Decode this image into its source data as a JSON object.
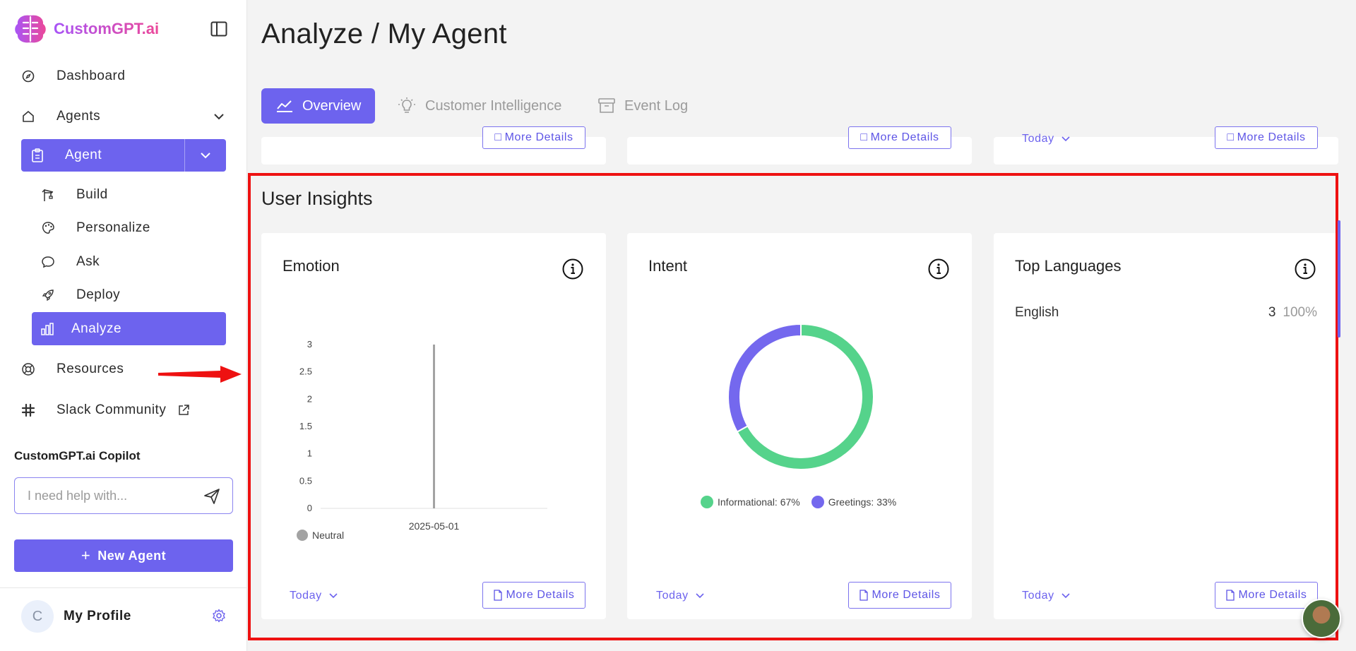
{
  "app": {
    "logo_text": "CustomGPT.ai"
  },
  "sidebar": {
    "items": [
      {
        "label": "Dashboard",
        "icon": "compass-icon"
      },
      {
        "label": "Agents",
        "icon": "home-icon"
      },
      {
        "label": "Agent",
        "icon": "clipboard-icon"
      },
      {
        "label": "Build",
        "icon": "crane-icon"
      },
      {
        "label": "Personalize",
        "icon": "palette-icon"
      },
      {
        "label": "Ask",
        "icon": "chat-bubble-icon"
      },
      {
        "label": "Deploy",
        "icon": "rocket-icon"
      },
      {
        "label": "Analyze",
        "icon": "bar-chart-icon"
      },
      {
        "label": "Resources",
        "icon": "lifebuoy-icon"
      },
      {
        "label": "Slack Community",
        "icon": "slack-icon"
      }
    ],
    "copilot_title": "CustomGPT.ai Copilot",
    "copilot_placeholder": "I need help with...",
    "new_agent_label": "New Agent",
    "profile_initial": "C",
    "profile_name": "My Profile"
  },
  "main": {
    "title": "Analyze / My Agent",
    "tabs": [
      {
        "label": "Overview",
        "active": true
      },
      {
        "label": "Customer Intelligence",
        "active": false
      },
      {
        "label": "Event Log",
        "active": false
      }
    ],
    "top_row": {
      "more_details_label": "More Details",
      "today_label": "Today"
    },
    "section_title": "User Insights",
    "cards": {
      "emotion": {
        "title": "Emotion",
        "today_label": "Today",
        "more_details_label": "More Details"
      },
      "intent": {
        "title": "Intent",
        "today_label": "Today",
        "more_details_label": "More Details"
      },
      "languages": {
        "title": "Top Languages",
        "today_label": "Today",
        "more_details_label": "More Details",
        "rows": [
          {
            "name": "English",
            "count": "3",
            "percent": "100%"
          }
        ]
      }
    }
  },
  "colors": {
    "accent": "#6d63ee",
    "informational": "#55d38b",
    "greetings": "#7468ee",
    "neutral": "#a3a3a3",
    "highlight": "#ee1111"
  },
  "chart_data": [
    {
      "type": "bar",
      "title": "Emotion",
      "categories": [
        "2025-05-01"
      ],
      "series": [
        {
          "name": "Neutral",
          "values": [
            3
          ]
        }
      ],
      "ylim": [
        0,
        3
      ],
      "yticks": [
        "0",
        "0.5",
        "1",
        "1.5",
        "2",
        "2.5",
        "3"
      ],
      "legend": "bottom-left"
    },
    {
      "type": "pie",
      "title": "Intent",
      "donut": true,
      "slices": [
        {
          "name": "Informational",
          "value": 67,
          "label": "Informational: 67%"
        },
        {
          "name": "Greetings",
          "value": 33,
          "label": "Greetings: 33%"
        }
      ],
      "legend": "bottom"
    }
  ]
}
